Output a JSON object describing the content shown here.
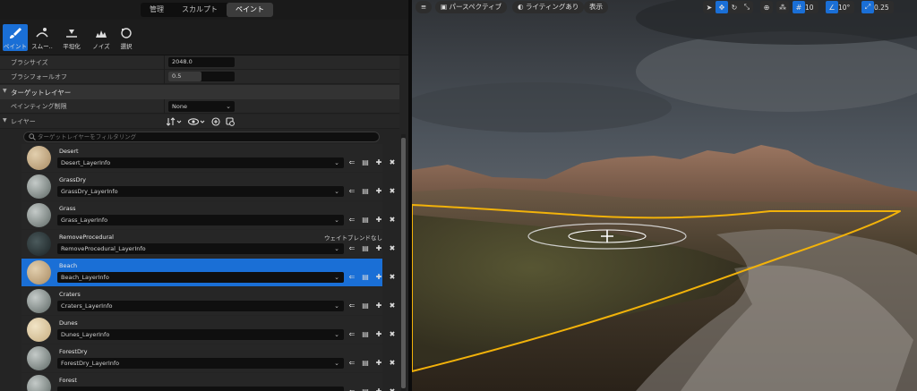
{
  "mode_tabs": {
    "manage": "管理",
    "sculpt": "スカルプト",
    "paint": "ペイント"
  },
  "tools": {
    "paint": "ペイント",
    "smooth": "スムー..",
    "flatten": "平坦化",
    "noise": "ノイズ",
    "select": "選択"
  },
  "props": {
    "brush_size_label": "ブラシサイズ",
    "brush_size_value": "2048.0",
    "brush_falloff_label": "ブラシフォールオフ",
    "brush_falloff_value": "0.5",
    "brush_falloff_fraction": 0.5
  },
  "target_section": {
    "label": "ターゲットレイヤー"
  },
  "paint_restriction": {
    "label": "ペインティング制限",
    "value": "None"
  },
  "layers_section": {
    "label": "レイヤー"
  },
  "search": {
    "placeholder": "ターゲットレイヤーをフィルタリング"
  },
  "layers": [
    {
      "name": "Desert",
      "info": "Desert_LayerInfo",
      "note": "",
      "selected": false,
      "thumb": "sand"
    },
    {
      "name": "GrassDry",
      "info": "GrassDry_LayerInfo",
      "note": "",
      "selected": false,
      "thumb": "rock"
    },
    {
      "name": "Grass",
      "info": "Grass_LayerInfo",
      "note": "",
      "selected": false,
      "thumb": "rock"
    },
    {
      "name": "RemoveProcedural",
      "info": "RemoveProcedural_LayerInfo",
      "note": "ウェイトブレンドなし",
      "selected": false,
      "thumb": "dark"
    },
    {
      "name": "Beach",
      "info": "Beach_LayerInfo",
      "note": "",
      "selected": true,
      "thumb": "sand"
    },
    {
      "name": "Craters",
      "info": "Craters_LayerInfo",
      "note": "",
      "selected": false,
      "thumb": "rock"
    },
    {
      "name": "Dunes",
      "info": "Dunes_LayerInfo",
      "note": "",
      "selected": false,
      "thumb": "cream"
    },
    {
      "name": "ForestDry",
      "info": "ForestDry_LayerInfo",
      "note": "",
      "selected": false,
      "thumb": "rock"
    },
    {
      "name": "Forest",
      "info": "",
      "note": "",
      "selected": false,
      "thumb": "rock"
    }
  ],
  "viewport": {
    "perspective": "パースペクティブ",
    "lighting": "ライティングあり",
    "show": "表示",
    "grid_snap": "10",
    "rot_snap": "10°",
    "scale_snap": "0.25"
  },
  "colors": {
    "accent": "#1a6fd6",
    "selection_outline": "#f2b20a",
    "panel_bg": "#242424"
  }
}
